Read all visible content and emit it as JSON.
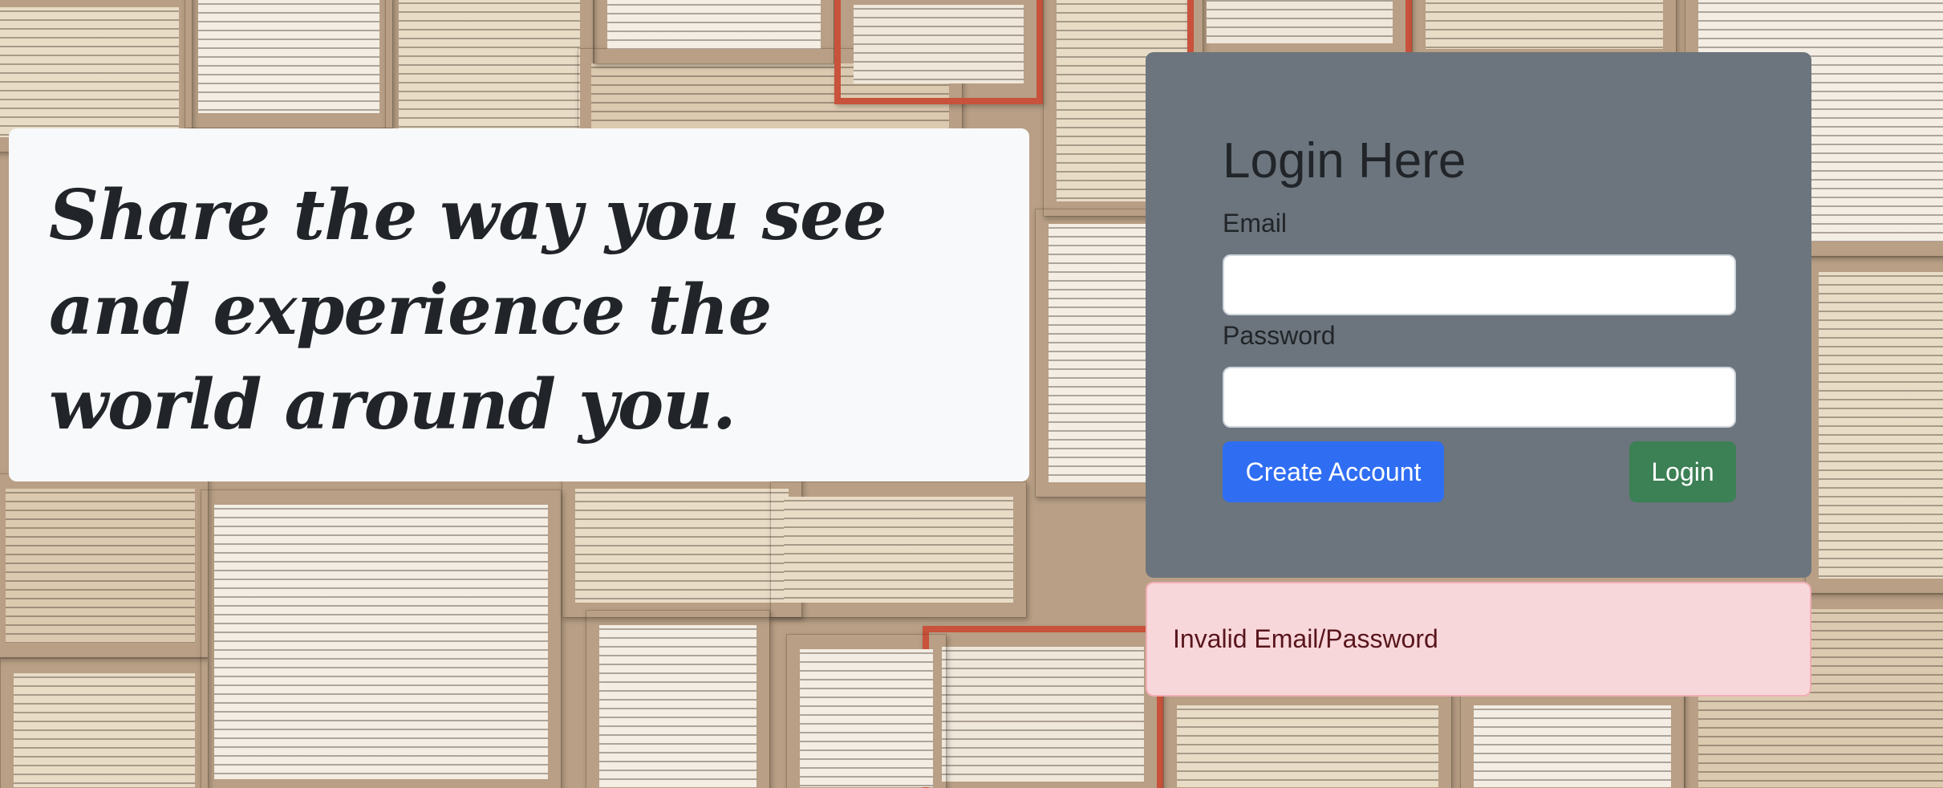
{
  "hero": {
    "tagline": "Share the way you see and experience the world around you."
  },
  "login": {
    "title": "Login Here",
    "email_label": "Email",
    "email_value": "",
    "password_label": "Password",
    "password_value": "",
    "create_account_label": "Create Account",
    "login_label": "Login"
  },
  "alert": {
    "message": "Invalid Email/Password"
  },
  "colors": {
    "hero_bg": "#f8f9fa",
    "panel_bg": "#6c757d",
    "primary": "#2f6ef3",
    "success": "#3c8055",
    "alert_bg": "#f8d7da",
    "alert_text": "#58151c"
  }
}
